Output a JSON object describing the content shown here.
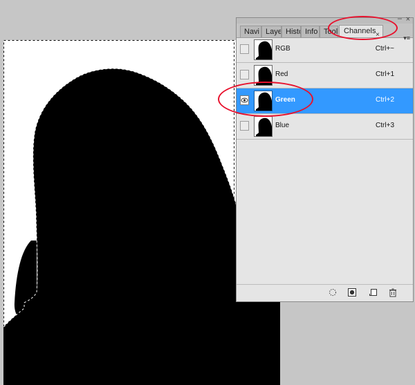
{
  "panel": {
    "tabs": [
      {
        "label": "Navi"
      },
      {
        "label": "Laye"
      },
      {
        "label": "Histo"
      },
      {
        "label": "Info"
      },
      {
        "label": "Tool"
      },
      {
        "label": "Channels",
        "active": true
      }
    ],
    "tab_close_glyph": "×",
    "window_close_glyph": "×",
    "window_minimize_glyph": "–",
    "menu_glyph": "▾≡",
    "channels": [
      {
        "name": "RGB",
        "shortcut": "Ctrl+~",
        "visible": false,
        "selected": false
      },
      {
        "name": "Red",
        "shortcut": "Ctrl+1",
        "visible": false,
        "selected": false
      },
      {
        "name": "Green",
        "shortcut": "Ctrl+2",
        "visible": true,
        "selected": true
      },
      {
        "name": "Blue",
        "shortcut": "Ctrl+3",
        "visible": false,
        "selected": false
      }
    ],
    "bottom_icons": [
      "load-selection-icon",
      "save-selection-icon",
      "new-channel-icon",
      "trash-icon"
    ]
  },
  "colors": {
    "selection_highlight": "#3399ff",
    "annotation_red": "#e8112d",
    "workspace": "#c6c6c6"
  }
}
